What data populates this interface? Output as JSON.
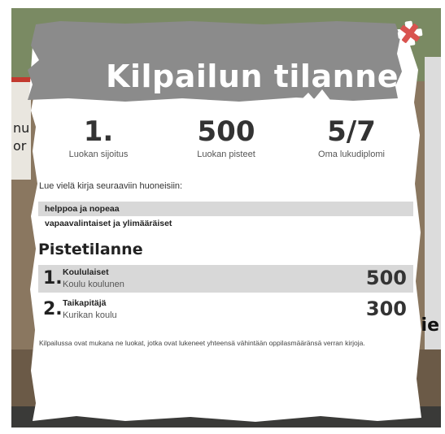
{
  "modal": {
    "title": "Kilpailun tilanne",
    "close_icon": "close-x-icon",
    "accent_color": "#d9534f",
    "header_color": "#8b8b8b"
  },
  "stats": [
    {
      "value": "1.",
      "label": "Luokan sijoitus"
    },
    {
      "value": "500",
      "label": "Luokan pisteet"
    },
    {
      "value": "5/7",
      "label": "Oma lukudiplomi"
    }
  ],
  "rooms": {
    "intro": "Lue vielä kirja seuraaviin huoneisiin:",
    "items": [
      "helppoa ja nopeaa",
      "vapaavalintaiset ja ylimääräiset"
    ]
  },
  "standings": {
    "title": "Pistetilanne",
    "rows": [
      {
        "rank": "1.",
        "name": "Koululaiset",
        "school": "Koulu koulunen",
        "points": "500"
      },
      {
        "rank": "2.",
        "name": "Taikapitäjä",
        "school": "Kurikan koulu",
        "points": "300"
      }
    ]
  },
  "footnote": "Kilpailussa ovat mukana ne luokat, jotka ovat lukeneet yhteensä vähintään oppilasmääränsä verran kirjoja.",
  "background": {
    "left_fragments": [
      "nu",
      "or"
    ],
    "right_fragments": [
      "ie"
    ]
  }
}
